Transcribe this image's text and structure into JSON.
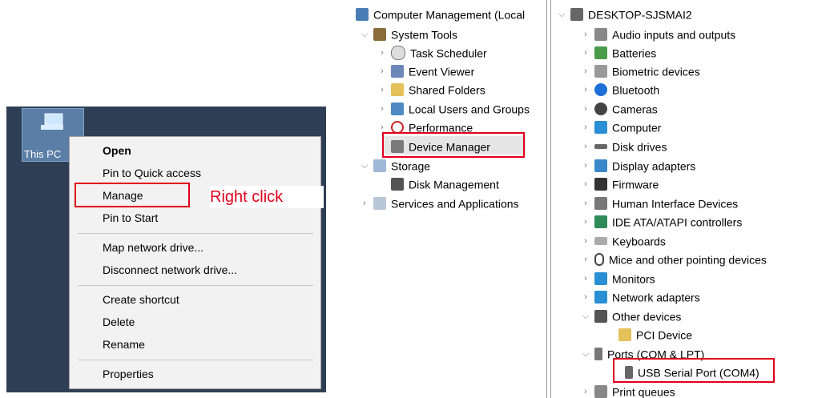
{
  "desktop": {
    "icon_label": "This PC",
    "icon_name": "this-pc-icon"
  },
  "context_menu": {
    "items": [
      {
        "label": "Open",
        "bold": true
      },
      {
        "label": "Pin to Quick access"
      },
      {
        "label": "Manage"
      },
      {
        "label": "Pin to Start"
      },
      {
        "label": "Map network drive..."
      },
      {
        "label": "Disconnect network drive..."
      },
      {
        "label": "Create shortcut"
      },
      {
        "label": "Delete"
      },
      {
        "label": "Rename"
      },
      {
        "label": "Properties"
      }
    ]
  },
  "annotation": {
    "right_click": "Right click",
    "highlight_color": "#e0001b"
  },
  "computer_management": {
    "root": "Computer Management (Local",
    "items": [
      {
        "label": "System Tools",
        "icon": "tools-icon"
      },
      {
        "label": "Task Scheduler",
        "icon": "clock-icon"
      },
      {
        "label": "Event Viewer",
        "icon": "event-viewer-icon"
      },
      {
        "label": "Shared Folders",
        "icon": "shared-folder-icon"
      },
      {
        "label": "Local Users and Groups",
        "icon": "users-icon"
      },
      {
        "label": "Performance",
        "icon": "performance-icon"
      },
      {
        "label": "Device Manager",
        "icon": "device-manager-icon"
      },
      {
        "label": "Storage",
        "icon": "storage-icon"
      },
      {
        "label": "Disk Management",
        "icon": "disk-management-icon"
      },
      {
        "label": "Services and Applications",
        "icon": "services-icon"
      }
    ]
  },
  "device_manager": {
    "root": "DESKTOP-SJSMAI2",
    "items": [
      {
        "label": "Audio inputs and outputs",
        "icon": "audio-icon"
      },
      {
        "label": "Batteries",
        "icon": "battery-icon"
      },
      {
        "label": "Biometric devices",
        "icon": "biometric-icon"
      },
      {
        "label": "Bluetooth",
        "icon": "bluetooth-icon"
      },
      {
        "label": "Cameras",
        "icon": "camera-icon"
      },
      {
        "label": "Computer",
        "icon": "computer-icon"
      },
      {
        "label": "Disk drives",
        "icon": "disk-drive-icon"
      },
      {
        "label": "Display adapters",
        "icon": "display-adapter-icon"
      },
      {
        "label": "Firmware",
        "icon": "firmware-icon"
      },
      {
        "label": "Human Interface Devices",
        "icon": "hid-icon"
      },
      {
        "label": "IDE ATA/ATAPI controllers",
        "icon": "ide-icon"
      },
      {
        "label": "Keyboards",
        "icon": "keyboard-icon"
      },
      {
        "label": "Mice and other pointing devices",
        "icon": "mouse-icon"
      },
      {
        "label": "Monitors",
        "icon": "monitor-icon"
      },
      {
        "label": "Network adapters",
        "icon": "network-icon"
      },
      {
        "label": "Other devices",
        "icon": "warning-device-icon"
      },
      {
        "label": "PCI Device",
        "icon": "pci-device-icon"
      },
      {
        "label": "Ports (COM & LPT)",
        "icon": "port-icon"
      },
      {
        "label": "USB Serial Port (COM4)",
        "icon": "usb-port-icon"
      },
      {
        "label": "Print queues",
        "icon": "printer-icon"
      }
    ]
  }
}
